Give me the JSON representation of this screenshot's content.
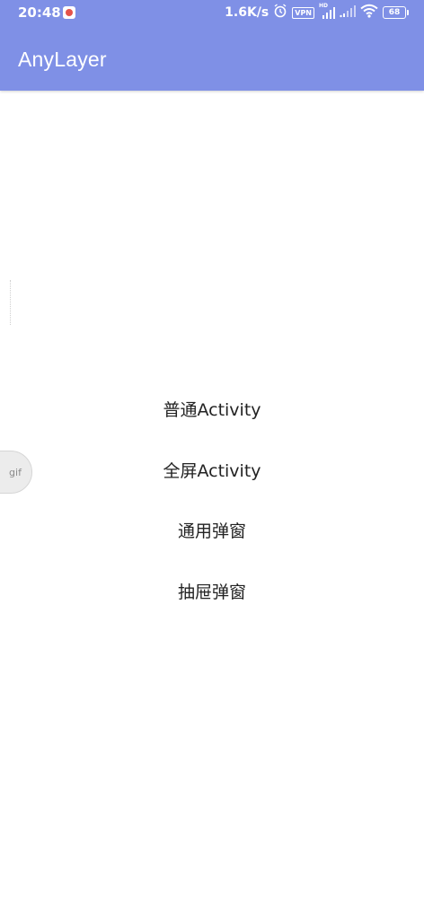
{
  "status_bar": {
    "time": "20:48",
    "network_speed": "1.6K/s",
    "vpn_label": "VPN",
    "hd_label": "HD",
    "battery_level": "68"
  },
  "toolbar": {
    "title": "AnyLayer"
  },
  "floating_button": {
    "label": "gif"
  },
  "menu": {
    "items": [
      {
        "label": "普通Activity"
      },
      {
        "label": "全屏Activity"
      },
      {
        "label": "通用弹窗"
      },
      {
        "label": "抽屉弹窗"
      }
    ]
  },
  "colors": {
    "primary": "#7f90e6",
    "background": "#ffffff",
    "text": "#222222"
  }
}
